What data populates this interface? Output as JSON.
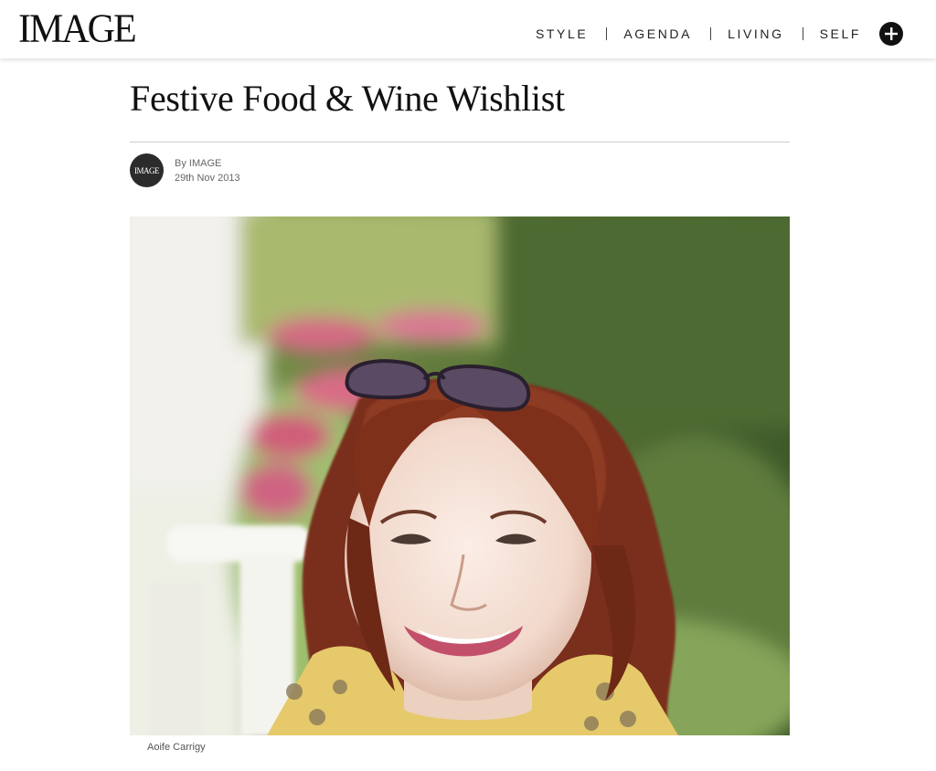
{
  "header": {
    "logo": "IMAGE",
    "nav": [
      "STYLE",
      "AGENDA",
      "LIVING",
      "SELF"
    ],
    "plus_icon": "plus-circle-icon"
  },
  "article": {
    "title": "Festive Food & Wine Wishlist",
    "author": "By IMAGE",
    "date": "29th Nov 2013",
    "avatar_text": "IMAGE",
    "caption": "Aoife Carrigy"
  }
}
